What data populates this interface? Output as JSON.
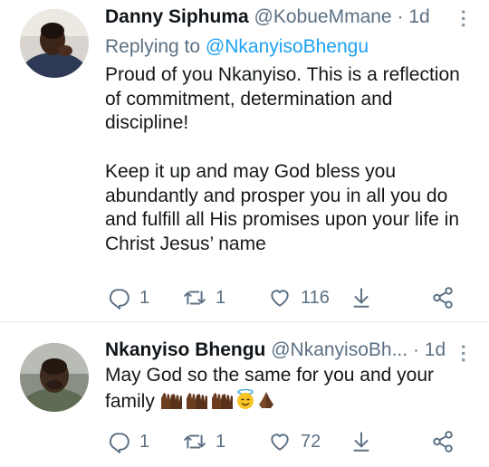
{
  "tweets": [
    {
      "author_name": "Danny Siphuma",
      "author_handle": "@KobueMmane",
      "separator": "·",
      "time": "1d",
      "replying_prefix": "Replying to ",
      "replying_to": "@NkanyisoBhengu",
      "text": "Proud of you Nkanyiso. This is a reflection of commitment, determination and discipline!\n\nKeep it up and may God bless you abundantly and prosper you in all you do and fulfill all His promises upon your life in Christ Jesus’ name",
      "reply_count": "1",
      "retweet_count": "1",
      "like_count": "116"
    },
    {
      "author_name": "Nkanyiso Bhengu",
      "author_handle": "@NkanyisoBh...",
      "separator": "·",
      "time": "1d",
      "text": "May God so the same for you and your family",
      "emojis": [
        "raising-hands",
        "raising-hands",
        "raising-hands",
        "smiling-face-with-halo",
        "folded-hands"
      ],
      "reply_count": "1",
      "retweet_count": "1",
      "like_count": "72"
    }
  ],
  "icons": {
    "reply": "reply-icon",
    "retweet": "retweet-icon",
    "like": "heart-icon",
    "download": "download-icon",
    "share": "share-icon",
    "more": "more-vertical-icon"
  },
  "colors": {
    "text": "#14171a",
    "secondary": "#5b7083",
    "link": "#1da1f2",
    "divider": "#e6ecf0"
  }
}
